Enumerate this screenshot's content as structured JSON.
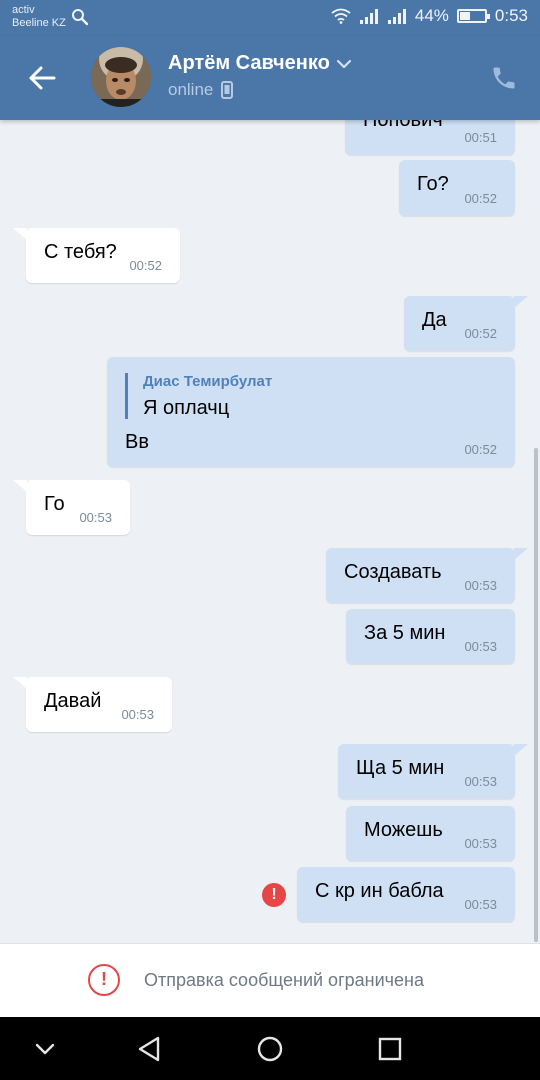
{
  "status_bar": {
    "carrier_line1": "activ",
    "carrier_line2": "Beeline KZ",
    "battery_percent": "44%",
    "battery_level": 0.44,
    "time": "0:53",
    "icons": [
      "search-icon",
      "wifi-icon",
      "signal-icon",
      "signal-icon",
      "battery-icon"
    ]
  },
  "header": {
    "contact_name": "Артём Савченко",
    "status": "online",
    "icons": [
      "back-arrow-icon",
      "chevron-down-icon",
      "mobile-icon",
      "phone-icon"
    ]
  },
  "messages": [
    {
      "direction": "out",
      "text": "Попович",
      "time": "00:51"
    },
    {
      "direction": "out",
      "text": "Го?",
      "time": "00:52"
    },
    {
      "direction": "in",
      "text": "С тебя?",
      "time": "00:52"
    },
    {
      "direction": "out",
      "text": "Да",
      "time": "00:52"
    },
    {
      "direction": "out",
      "reply_author": "Диас Темирбулат",
      "reply_text": "Я оплачц",
      "text": "Вв",
      "time": "00:52"
    },
    {
      "direction": "in",
      "text": "Го",
      "time": "00:53"
    },
    {
      "direction": "out",
      "text": "Создавать",
      "time": "00:53"
    },
    {
      "direction": "out",
      "text": "За 5 мин",
      "time": "00:53"
    },
    {
      "direction": "in",
      "text": "Давай",
      "time": "00:53"
    },
    {
      "direction": "out",
      "text": "Ща 5 мин",
      "time": "00:53"
    },
    {
      "direction": "out",
      "text": "Можешь",
      "time": "00:53"
    },
    {
      "direction": "out",
      "text": "С кр ин бабла",
      "time": "00:53",
      "failed": true
    }
  ],
  "footer": {
    "notice": "Отправка сообщений ограничена",
    "icon": "alert-circle-icon"
  },
  "nav_bar": {
    "icons": [
      "chevron-down-icon",
      "back-triangle-icon",
      "home-circle-icon",
      "recents-square-icon"
    ]
  },
  "colors": {
    "header": "#4a76a8",
    "outgoing_bubble": "#cfe0f5",
    "incoming_bubble": "#ffffff",
    "chat_background": "#edf0f4",
    "error": "#e64646",
    "link": "#5181b8"
  }
}
